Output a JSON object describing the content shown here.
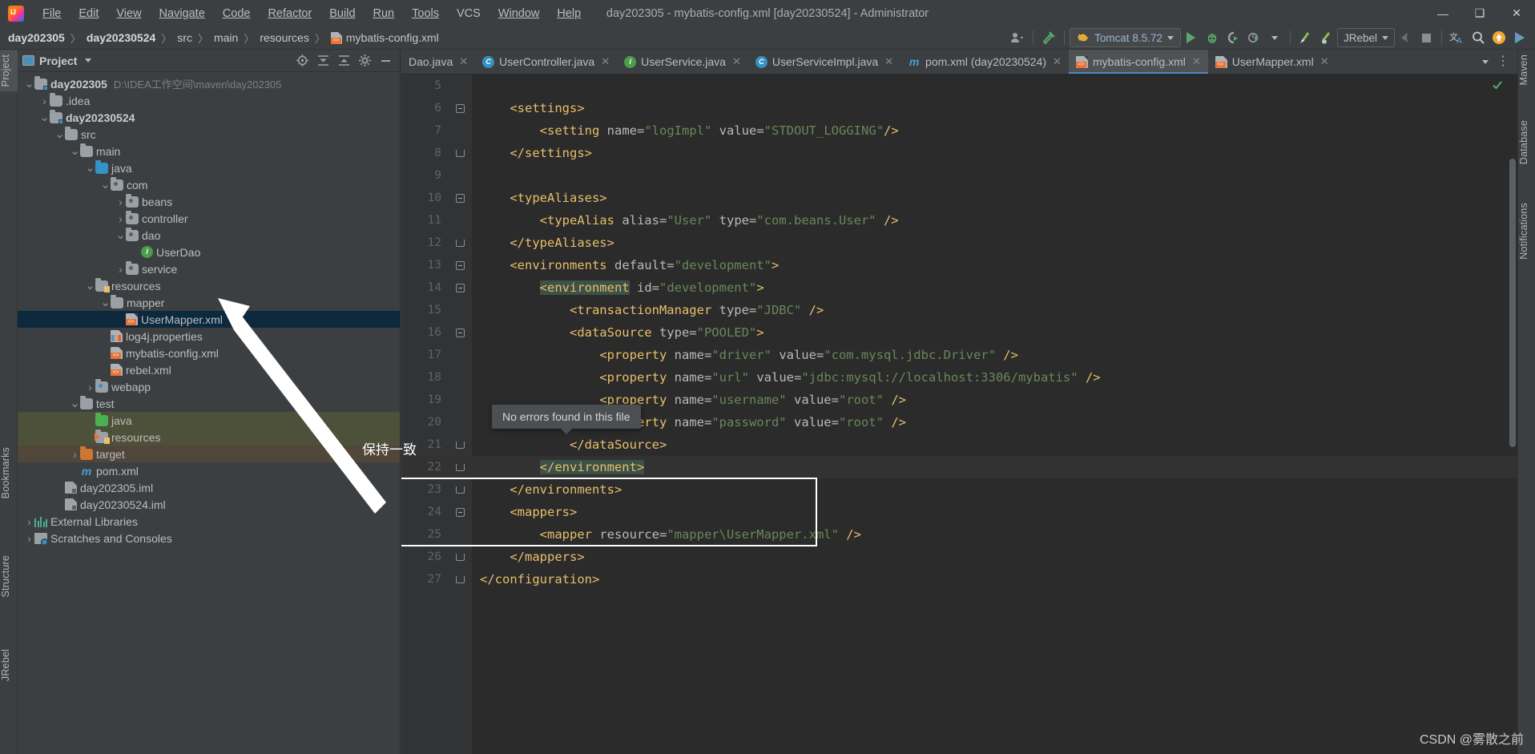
{
  "window": {
    "title": "day202305 - mybatis-config.xml [day20230524] - Administrator",
    "minimize": "—",
    "maximize": "❑",
    "close": "✕"
  },
  "menubar": {
    "items": [
      "File",
      "Edit",
      "View",
      "Navigate",
      "Code",
      "Refactor",
      "Build",
      "Run",
      "Tools",
      "VCS",
      "Window",
      "Help"
    ]
  },
  "breadcrumb": {
    "items": [
      "day202305",
      "day20230524",
      "src",
      "main",
      "resources",
      "mybatis-config.xml"
    ],
    "separator": "〉"
  },
  "toolbar": {
    "run_config": "Tomcat 8.5.72",
    "jrebel_config": "JRebel",
    "icons": [
      "user-dropdown-icon",
      "build-hammer-icon",
      "run-icon",
      "debug-icon",
      "run-coverage-icon",
      "profiler-icon",
      "jrebel-run-icon",
      "jrebel-debug-icon",
      "back-icon",
      "stop-icon",
      "translate-icon",
      "search-icon",
      "update-icon",
      "ide-icon"
    ]
  },
  "left_strip": {
    "tabs": [
      "Project",
      "Bookmarks",
      "Structure",
      "JRebel"
    ]
  },
  "right_strip": {
    "tabs": [
      "Maven",
      "Database",
      "Notifications"
    ]
  },
  "project_panel": {
    "title": "Project",
    "header_icons": [
      "locate-icon",
      "expand-all-icon",
      "collapse-all-icon",
      "settings-gear-icon",
      "hide-icon"
    ],
    "tree": [
      {
        "label": "day202305",
        "path": "D:\\IDEA工作空间\\maven\\day202305",
        "indent": 0,
        "arrow": "down",
        "icon": "module-folder",
        "bold": true,
        "state": "normal"
      },
      {
        "label": ".idea",
        "path": "",
        "indent": 1,
        "arrow": "right",
        "icon": "folder",
        "bold": false,
        "state": "normal"
      },
      {
        "label": "day20230524",
        "path": "",
        "indent": 1,
        "arrow": "down",
        "icon": "module-folder",
        "bold": true,
        "state": "normal"
      },
      {
        "label": "src",
        "path": "",
        "indent": 2,
        "arrow": "down",
        "icon": "folder",
        "bold": false,
        "state": "normal"
      },
      {
        "label": "main",
        "path": "",
        "indent": 3,
        "arrow": "down",
        "icon": "folder",
        "bold": false,
        "state": "normal"
      },
      {
        "label": "java",
        "path": "",
        "indent": 4,
        "arrow": "down",
        "icon": "source-folder",
        "bold": false,
        "state": "normal"
      },
      {
        "label": "com",
        "path": "",
        "indent": 5,
        "arrow": "down",
        "icon": "package",
        "bold": false,
        "state": "normal"
      },
      {
        "label": "beans",
        "path": "",
        "indent": 6,
        "arrow": "right",
        "icon": "package",
        "bold": false,
        "state": "normal"
      },
      {
        "label": "controller",
        "path": "",
        "indent": 6,
        "arrow": "right",
        "icon": "package",
        "bold": false,
        "state": "normal"
      },
      {
        "label": "dao",
        "path": "",
        "indent": 6,
        "arrow": "down",
        "icon": "package",
        "bold": false,
        "state": "normal"
      },
      {
        "label": "UserDao",
        "path": "",
        "indent": 7,
        "arrow": "",
        "icon": "interface",
        "bold": false,
        "state": "normal"
      },
      {
        "label": "service",
        "path": "",
        "indent": 6,
        "arrow": "right",
        "icon": "package",
        "bold": false,
        "state": "normal"
      },
      {
        "label": "resources",
        "path": "",
        "indent": 4,
        "arrow": "down",
        "icon": "resource-folder",
        "bold": false,
        "state": "normal"
      },
      {
        "label": "mapper",
        "path": "",
        "indent": 5,
        "arrow": "down",
        "icon": "folder",
        "bold": false,
        "state": "normal"
      },
      {
        "label": "UserMapper.xml",
        "path": "",
        "indent": 6,
        "arrow": "",
        "icon": "xml-file",
        "bold": false,
        "state": "selected"
      },
      {
        "label": "log4j.properties",
        "path": "",
        "indent": 5,
        "arrow": "",
        "icon": "properties-file",
        "bold": false,
        "state": "normal"
      },
      {
        "label": "mybatis-config.xml",
        "path": "",
        "indent": 5,
        "arrow": "",
        "icon": "xml-file",
        "bold": false,
        "state": "normal"
      },
      {
        "label": "rebel.xml",
        "path": "",
        "indent": 5,
        "arrow": "",
        "icon": "xml-file",
        "bold": false,
        "state": "normal"
      },
      {
        "label": "webapp",
        "path": "",
        "indent": 4,
        "arrow": "right",
        "icon": "web-folder",
        "bold": false,
        "state": "normal"
      },
      {
        "label": "test",
        "path": "",
        "indent": 3,
        "arrow": "down",
        "icon": "folder",
        "bold": false,
        "state": "normal"
      },
      {
        "label": "java",
        "path": "",
        "indent": 4,
        "arrow": "",
        "icon": "test-source-folder",
        "bold": false,
        "state": "test"
      },
      {
        "label": "resources",
        "path": "",
        "indent": 4,
        "arrow": "",
        "icon": "test-resource-folder",
        "bold": false,
        "state": "test"
      },
      {
        "label": "target",
        "path": "",
        "indent": 3,
        "arrow": "right",
        "icon": "excluded-folder",
        "bold": false,
        "state": "excluded"
      },
      {
        "label": "pom.xml",
        "path": "",
        "indent": 3,
        "arrow": "",
        "icon": "maven-file",
        "bold": false,
        "state": "normal"
      },
      {
        "label": "day202305.iml",
        "path": "",
        "indent": 2,
        "arrow": "",
        "icon": "iml-file",
        "bold": false,
        "state": "normal"
      },
      {
        "label": "day20230524.iml",
        "path": "",
        "indent": 2,
        "arrow": "",
        "icon": "iml-file",
        "bold": false,
        "state": "normal"
      },
      {
        "label": "External Libraries",
        "path": "",
        "indent": 0,
        "arrow": "right",
        "icon": "library",
        "bold": false,
        "state": "normal"
      },
      {
        "label": "Scratches and Consoles",
        "path": "",
        "indent": 0,
        "arrow": "right",
        "icon": "scratches",
        "bold": false,
        "state": "normal"
      }
    ]
  },
  "editor": {
    "tabs": [
      {
        "label": "Dao.java",
        "icon": "java-class-icon",
        "active": false,
        "partial": true
      },
      {
        "label": "UserController.java",
        "icon": "java-class-icon",
        "active": false,
        "partial": false
      },
      {
        "label": "UserService.java",
        "icon": "java-interface-icon",
        "active": false,
        "partial": false
      },
      {
        "label": "UserServiceImpl.java",
        "icon": "java-class-icon",
        "active": false,
        "partial": false
      },
      {
        "label": "pom.xml (day20230524)",
        "icon": "maven-file-icon",
        "active": false,
        "partial": false
      },
      {
        "label": "mybatis-config.xml",
        "icon": "xml-file-icon",
        "active": true,
        "partial": false
      },
      {
        "label": "UserMapper.xml",
        "icon": "xml-file-icon",
        "active": false,
        "partial": false
      }
    ],
    "close_glyph": "✕",
    "lines": [
      {
        "num": "5",
        "fold": "",
        "indent": 0,
        "highlight": false,
        "tokens": []
      },
      {
        "num": "6",
        "fold": "open",
        "indent": 1,
        "highlight": false,
        "tokens": [
          {
            "t": "    ",
            "c": "pn"
          },
          {
            "t": "<settings>",
            "c": "k"
          }
        ]
      },
      {
        "num": "7",
        "fold": "",
        "indent": 2,
        "highlight": false,
        "tokens": [
          {
            "t": "        ",
            "c": "pn"
          },
          {
            "t": "<setting ",
            "c": "k"
          },
          {
            "t": "name=",
            "c": "at"
          },
          {
            "t": "\"logImpl\"",
            "c": "st"
          },
          {
            "t": " ",
            "c": "pn"
          },
          {
            "t": "value=",
            "c": "at"
          },
          {
            "t": "\"STDOUT_LOGGING\"",
            "c": "st"
          },
          {
            "t": "/>",
            "c": "k"
          }
        ]
      },
      {
        "num": "8",
        "fold": "close",
        "indent": 1,
        "highlight": false,
        "tokens": [
          {
            "t": "    ",
            "c": "pn"
          },
          {
            "t": "</settings>",
            "c": "k"
          }
        ]
      },
      {
        "num": "9",
        "fold": "",
        "indent": 0,
        "highlight": false,
        "tokens": []
      },
      {
        "num": "10",
        "fold": "open",
        "indent": 1,
        "highlight": false,
        "tokens": [
          {
            "t": "    ",
            "c": "pn"
          },
          {
            "t": "<typeAliases>",
            "c": "k"
          }
        ]
      },
      {
        "num": "11",
        "fold": "",
        "indent": 2,
        "highlight": false,
        "tokens": [
          {
            "t": "        ",
            "c": "pn"
          },
          {
            "t": "<typeAlias ",
            "c": "k"
          },
          {
            "t": "alias=",
            "c": "at"
          },
          {
            "t": "\"User\"",
            "c": "st"
          },
          {
            "t": " ",
            "c": "pn"
          },
          {
            "t": "type=",
            "c": "at"
          },
          {
            "t": "\"com.beans.User\"",
            "c": "st"
          },
          {
            "t": " />",
            "c": "k"
          }
        ]
      },
      {
        "num": "12",
        "fold": "close",
        "indent": 1,
        "highlight": false,
        "tokens": [
          {
            "t": "    ",
            "c": "pn"
          },
          {
            "t": "</typeAliases>",
            "c": "k"
          }
        ]
      },
      {
        "num": "13",
        "fold": "open",
        "indent": 1,
        "highlight": false,
        "tokens": [
          {
            "t": "    ",
            "c": "pn"
          },
          {
            "t": "<environments ",
            "c": "k"
          },
          {
            "t": "default=",
            "c": "at"
          },
          {
            "t": "\"development\"",
            "c": "st"
          },
          {
            "t": ">",
            "c": "k"
          }
        ]
      },
      {
        "num": "14",
        "fold": "open",
        "indent": 2,
        "highlight": false,
        "tokens": [
          {
            "t": "        ",
            "c": "pn"
          },
          {
            "t": "<environment",
            "c": "k sel-tag"
          },
          {
            "t": " ",
            "c": "pn"
          },
          {
            "t": "id=",
            "c": "at"
          },
          {
            "t": "\"development\"",
            "c": "st"
          },
          {
            "t": ">",
            "c": "k"
          }
        ]
      },
      {
        "num": "15",
        "fold": "",
        "indent": 3,
        "highlight": false,
        "tokens": [
          {
            "t": "            ",
            "c": "pn"
          },
          {
            "t": "<transactionManager ",
            "c": "k"
          },
          {
            "t": "type=",
            "c": "at"
          },
          {
            "t": "\"JDBC\"",
            "c": "st"
          },
          {
            "t": " />",
            "c": "k"
          }
        ]
      },
      {
        "num": "16",
        "fold": "open",
        "indent": 3,
        "highlight": false,
        "tokens": [
          {
            "t": "            ",
            "c": "pn"
          },
          {
            "t": "<dataSource ",
            "c": "k"
          },
          {
            "t": "type=",
            "c": "at"
          },
          {
            "t": "\"POOLED\"",
            "c": "st"
          },
          {
            "t": ">",
            "c": "k"
          }
        ]
      },
      {
        "num": "17",
        "fold": "",
        "indent": 4,
        "highlight": false,
        "tokens": [
          {
            "t": "                ",
            "c": "pn"
          },
          {
            "t": "<property ",
            "c": "k"
          },
          {
            "t": "name=",
            "c": "at"
          },
          {
            "t": "\"driver\"",
            "c": "st"
          },
          {
            "t": " ",
            "c": "pn"
          },
          {
            "t": "value=",
            "c": "at"
          },
          {
            "t": "\"com.mysql.jdbc.Driver\"",
            "c": "st"
          },
          {
            "t": " />",
            "c": "k"
          }
        ]
      },
      {
        "num": "18",
        "fold": "",
        "indent": 4,
        "highlight": false,
        "tokens": [
          {
            "t": "                ",
            "c": "pn"
          },
          {
            "t": "<property ",
            "c": "k"
          },
          {
            "t": "name=",
            "c": "at"
          },
          {
            "t": "\"url\"",
            "c": "st"
          },
          {
            "t": " ",
            "c": "pn"
          },
          {
            "t": "value=",
            "c": "at"
          },
          {
            "t": "\"jdbc:mysql://localhost:3306/mybatis\"",
            "c": "st"
          },
          {
            "t": " />",
            "c": "k"
          }
        ]
      },
      {
        "num": "19",
        "fold": "",
        "indent": 4,
        "highlight": false,
        "tokens": [
          {
            "t": "                ",
            "c": "pn"
          },
          {
            "t": "<property ",
            "c": "k"
          },
          {
            "t": "name=",
            "c": "at"
          },
          {
            "t": "\"username\"",
            "c": "st"
          },
          {
            "t": " ",
            "c": "pn"
          },
          {
            "t": "value=",
            "c": "at"
          },
          {
            "t": "\"root\"",
            "c": "st"
          },
          {
            "t": " />",
            "c": "k"
          }
        ]
      },
      {
        "num": "20",
        "fold": "",
        "indent": 4,
        "highlight": false,
        "tokens": [
          {
            "t": "                ",
            "c": "pn"
          },
          {
            "t": "<property ",
            "c": "k"
          },
          {
            "t": "name=",
            "c": "at"
          },
          {
            "t": "\"password\"",
            "c": "st"
          },
          {
            "t": " ",
            "c": "pn"
          },
          {
            "t": "value=",
            "c": "at"
          },
          {
            "t": "\"root\"",
            "c": "st"
          },
          {
            "t": " />",
            "c": "k"
          }
        ]
      },
      {
        "num": "21",
        "fold": "close",
        "indent": 3,
        "highlight": false,
        "tokens": [
          {
            "t": "            ",
            "c": "pn"
          },
          {
            "t": "</dataSource>",
            "c": "k"
          }
        ]
      },
      {
        "num": "22",
        "fold": "close",
        "indent": 2,
        "highlight": true,
        "tokens": [
          {
            "t": "        ",
            "c": "pn"
          },
          {
            "t": "</environment>",
            "c": "k sel-tag"
          }
        ]
      },
      {
        "num": "23",
        "fold": "close",
        "indent": 1,
        "highlight": false,
        "tokens": [
          {
            "t": "    ",
            "c": "pn"
          },
          {
            "t": "</environments>",
            "c": "k"
          }
        ]
      },
      {
        "num": "24",
        "fold": "open",
        "indent": 1,
        "highlight": false,
        "tokens": [
          {
            "t": "    ",
            "c": "pn"
          },
          {
            "t": "<mappers>",
            "c": "k"
          }
        ]
      },
      {
        "num": "25",
        "fold": "",
        "indent": 2,
        "highlight": false,
        "tokens": [
          {
            "t": "        ",
            "c": "pn"
          },
          {
            "t": "<mapper ",
            "c": "k"
          },
          {
            "t": "resource=",
            "c": "at"
          },
          {
            "t": "\"mapper\\UserMapper.xml\"",
            "c": "st"
          },
          {
            "t": " />",
            "c": "k"
          }
        ]
      },
      {
        "num": "26",
        "fold": "close",
        "indent": 1,
        "highlight": false,
        "tokens": [
          {
            "t": "    ",
            "c": "pn"
          },
          {
            "t": "</mappers>",
            "c": "k"
          }
        ]
      },
      {
        "num": "27",
        "fold": "close",
        "indent": 0,
        "highlight": false,
        "tokens": [
          {
            "t": "</configuration>",
            "c": "k"
          }
        ]
      }
    ]
  },
  "tooltip": {
    "text": "No errors found in this file"
  },
  "annotation": {
    "label": "保持一致"
  },
  "watermark": {
    "text": "CSDN @雾散之前"
  },
  "colors": {
    "accent": "#4a88c7",
    "selection": "#0d293e",
    "tag": "#e8bf6a",
    "string": "#6a8759",
    "ok": "#59a869",
    "background": "#2b2b2b",
    "chrome": "#3c3f41"
  }
}
